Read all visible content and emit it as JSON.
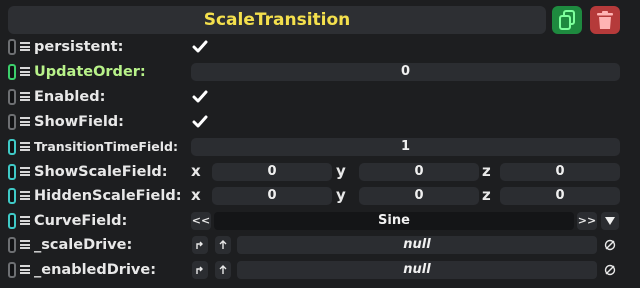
{
  "header": {
    "title": "ScaleTransition"
  },
  "fields": {
    "persistent": {
      "label": "persistent:",
      "checked": true
    },
    "update_order": {
      "label": "UpdateOrder:",
      "value": "0"
    },
    "enabled": {
      "label": "Enabled:",
      "checked": true
    },
    "show_field": {
      "label": "ShowField:",
      "checked": true
    },
    "transition_time": {
      "label": "TransitionTimeField:",
      "value": "1"
    },
    "show_scale": {
      "label": "ShowScaleField:",
      "x_label": "x",
      "y_label": "y",
      "z_label": "z",
      "x": "0",
      "y": "0",
      "z": "0"
    },
    "hidden_scale": {
      "label": "HiddenScaleField:",
      "x_label": "x",
      "y_label": "y",
      "z_label": "z",
      "x": "0",
      "y": "0",
      "z": "0"
    },
    "curve": {
      "label": "CurveField:",
      "value": "Sine",
      "prev_label": "<<",
      "next_label": ">>"
    },
    "scale_drive": {
      "label": "_scaleDrive:",
      "value": "null"
    },
    "enabled_drive": {
      "label": "_enabledDrive:",
      "value": "null"
    }
  },
  "colors": {
    "title": "#f4e04d",
    "green_label": "#b8f28a",
    "duplicate_button": "#1e8a3f",
    "delete_button": "#b53a3a"
  },
  "icons": [
    "duplicate-icon",
    "trash-icon",
    "checkmark-icon",
    "hamburger-icon",
    "dropdown-arrow-icon",
    "jump-icon",
    "up-arrow-icon",
    "clear-icon"
  ]
}
